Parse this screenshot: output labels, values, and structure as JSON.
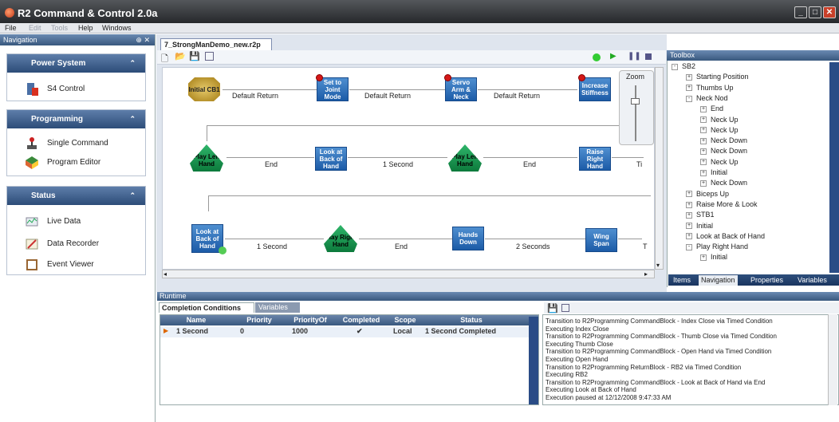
{
  "window": {
    "title": "R2 Command & Control 2.0a"
  },
  "menu": [
    "File",
    "Edit",
    "Tools",
    "Help",
    "Windows"
  ],
  "navigation": {
    "title": "Navigation",
    "groups": [
      {
        "title": "Power System",
        "items": [
          "S4 Control"
        ]
      },
      {
        "title": "Programming",
        "items": [
          "Single Command",
          "Program Editor"
        ]
      },
      {
        "title": "Status",
        "items": [
          "Live Data",
          "Data Recorder",
          "Event Viewer"
        ]
      }
    ]
  },
  "document": {
    "tab": "7_StrongManDemo_new.r2p",
    "zoom_label": "Zoom",
    "nodes": [
      "Initial CB1",
      "Set to Joint Mode",
      "Servo Arm & Neck",
      "Increase Stiffness",
      "Play Left Hand",
      "Look at Back of Hand",
      "Play Left Hand",
      "Raise Right Hand",
      "Look at Back of Hand",
      "Play Right Hand",
      "Hands Down",
      "Wing Span"
    ],
    "edges": [
      "Default Return",
      "Default Return",
      "Default Return",
      "End",
      "1 Second",
      "End",
      "Ti",
      "1 Second",
      "End",
      "2 Seconds",
      "T"
    ]
  },
  "toolbox": {
    "title": "Toolbox",
    "items": [
      {
        "label": "SB2",
        "level": 0,
        "sign": "-"
      },
      {
        "label": "Starting Position",
        "level": 1,
        "sign": "+"
      },
      {
        "label": "Thumbs Up",
        "level": 1,
        "sign": "+"
      },
      {
        "label": "Neck Nod",
        "level": 1,
        "sign": "-"
      },
      {
        "label": "End",
        "level": 2,
        "sign": "+"
      },
      {
        "label": "Neck Up",
        "level": 2,
        "sign": "+"
      },
      {
        "label": "Neck Up",
        "level": 2,
        "sign": "+"
      },
      {
        "label": "Neck Down",
        "level": 2,
        "sign": "+"
      },
      {
        "label": "Neck Down",
        "level": 2,
        "sign": "+"
      },
      {
        "label": "Neck Up",
        "level": 2,
        "sign": "+"
      },
      {
        "label": "Initial",
        "level": 2,
        "sign": "+"
      },
      {
        "label": "Neck Down",
        "level": 2,
        "sign": "+"
      },
      {
        "label": "Biceps Up",
        "level": 1,
        "sign": "+"
      },
      {
        "label": "Raise More & Look",
        "level": 1,
        "sign": "+"
      },
      {
        "label": "STB1",
        "level": 1,
        "sign": "+"
      },
      {
        "label": "Initial",
        "level": 1,
        "sign": "+"
      },
      {
        "label": "Look at Back of Hand",
        "level": 1,
        "sign": "+"
      },
      {
        "label": "Play Right Hand",
        "level": 1,
        "sign": "-"
      },
      {
        "label": "Initial",
        "level": 2,
        "sign": "+"
      }
    ],
    "tabs": [
      "Items",
      "Navigation",
      "Properties",
      "Variables"
    ]
  },
  "runtime": {
    "title": "Runtime",
    "tabs": [
      "Completion Conditions",
      "Variables"
    ],
    "columns": [
      "Name",
      "Priority",
      "PriorityOf",
      "Completed",
      "Scope",
      "Status"
    ],
    "row": {
      "name": "1 Second",
      "priority": "0",
      "priorityof": "1000",
      "completed": "✔",
      "scope": "Local",
      "status": "1 Second Completed"
    },
    "log": [
      "Transition to R2Programming CommandBlock - Index Close via Timed Condition",
      "Executing Index Close",
      "Transition to R2Programming CommandBlock - Thumb Close via Timed Condition",
      "Executing Thumb Close",
      "Transition to R2Programming CommandBlock - Open Hand via Timed Condition",
      "Executing Open Hand",
      "Transition to R2Programming ReturnBlock - RB2 via Timed Condition",
      "Executing RB2",
      "Transition to R2Programming CommandBlock - Look at Back of Hand via End",
      "Executing Look at Back of Hand",
      "Execution paused at 12/12/2008 9:47:33 AM"
    ]
  }
}
